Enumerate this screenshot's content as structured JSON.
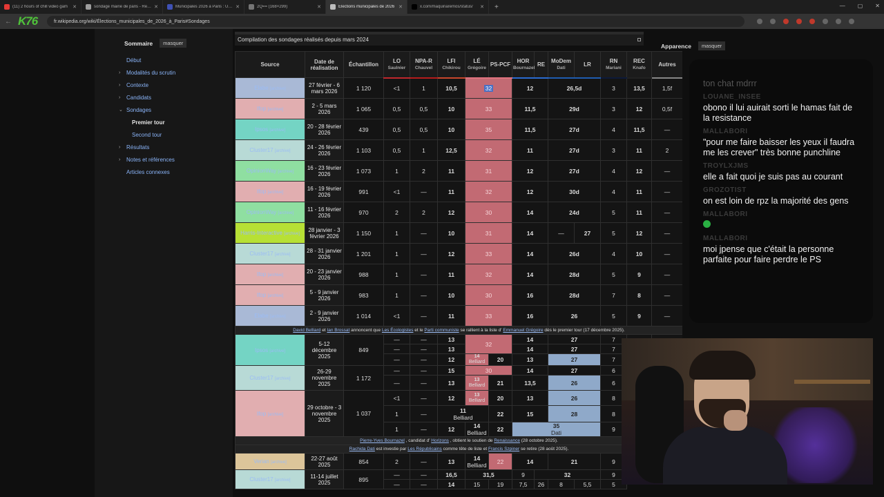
{
  "tabs": [
    {
      "title": "(11) 2 hours of chill video gam",
      "color": "#e53935",
      "active": false
    },
    {
      "title": "sondage mairie de paris - Rech",
      "color": "#9e9e9e",
      "active": false
    },
    {
      "title": "Municipales 2026 à Paris : Un s",
      "color": "#3f51b5",
      "active": false
    },
    {
      "title": "2Q== (168×299)",
      "color": "#757575",
      "active": false
    },
    {
      "title": "Élections municipales de 2026",
      "color": "#bdbdbd",
      "active": true
    },
    {
      "title": "x.com/maquinaremos/status/",
      "color": "#000000",
      "active": false
    }
  ],
  "url": "fr.wikipedia.org/wiki/Élections_municipales_de_2026_à_Paris#Sondages",
  "logo": "K76",
  "toc": {
    "title": "Sommaire",
    "hide": "masquer",
    "items": [
      {
        "label": "Début",
        "arrow": "",
        "level": 0,
        "current": false
      },
      {
        "label": "Modalités du scrutin",
        "arrow": "›",
        "level": 0,
        "current": false
      },
      {
        "label": "Contexte",
        "arrow": "›",
        "level": 0,
        "current": false
      },
      {
        "label": "Candidats",
        "arrow": "›",
        "level": 0,
        "current": false
      },
      {
        "label": "Sondages",
        "arrow": "⌄",
        "level": 0,
        "current": false
      },
      {
        "label": "Premier tour",
        "arrow": "",
        "level": 1,
        "current": true
      },
      {
        "label": "Second tour",
        "arrow": "",
        "level": 1,
        "current": false
      },
      {
        "label": "Résultats",
        "arrow": "›",
        "level": 0,
        "current": false
      },
      {
        "label": "Notes et références",
        "arrow": "›",
        "level": 0,
        "current": false
      },
      {
        "label": "Articles connexes",
        "arrow": "",
        "level": 0,
        "current": false
      }
    ]
  },
  "caption": "Compilation des sondages réalisés depuis mars 2024",
  "appearance": {
    "title": "Apparence",
    "hide": "masquer"
  },
  "table": {
    "headers": {
      "source": "Source",
      "date": "Date de réalisation",
      "sample": "Échantillon",
      "parties": [
        {
          "party": "LO",
          "cand": "Saulnier",
          "color": "#c1272d"
        },
        {
          "party": "NPA-R",
          "cand": "Chauvel",
          "color": "#b71c1c"
        },
        {
          "party": "LFI",
          "cand": "Chikirou",
          "color": "#c9462c"
        },
        {
          "party": "LÉ",
          "cand": "Grégoire",
          "color": "#e0737f"
        },
        {
          "party": "PS-PCF",
          "cand": "",
          "color": "#e0737f"
        },
        {
          "party": "HOR",
          "cand": "Bournazel",
          "color": "#2a6bd1"
        },
        {
          "party": "RE",
          "cand": "",
          "color": "#2a6bd1"
        },
        {
          "party": "MoDem",
          "cand": "Dati",
          "color": "#1f5db2"
        },
        {
          "party": "LR",
          "cand": "",
          "color": "#1f5db2"
        },
        {
          "party": "RN",
          "cand": "Mariani",
          "color": "#0d1a3a"
        },
        {
          "party": "REC",
          "cand": "Knafo",
          "color": "#222222"
        },
        {
          "party": "Autres",
          "cand": "",
          "color": "#888888"
        }
      ]
    },
    "archive": "[archive]",
    "rows": [
      {
        "src": "Elabe",
        "cls": "sc-elabe",
        "date": "27 février - 6 mars 2026",
        "n": "1 120",
        "v": [
          "<1",
          "1",
          "10,5",
          "32",
          "12",
          "26,5d",
          "3",
          "13,5",
          "1,5f"
        ]
      },
      {
        "src": "Ifop",
        "cls": "sc-ifop",
        "date": "2 - 5 mars 2026",
        "n": "1 065",
        "v": [
          "0,5",
          "0,5",
          "10",
          "33",
          "11,5",
          "29d",
          "3",
          "12",
          "0,5f"
        ]
      },
      {
        "src": "Ipsos",
        "cls": "sc-ipsos",
        "date": "20 - 28 février 2026",
        "n": "439",
        "v": [
          "0,5",
          "0,5",
          "10",
          "35",
          "11,5",
          "27d",
          "4",
          "11,5",
          "—"
        ]
      },
      {
        "src": "Cluster17",
        "cls": "sc-cl17",
        "date": "24 - 26 février 2026",
        "n": "1 103",
        "v": [
          "0,5",
          "1",
          "12,5",
          "32",
          "11",
          "27d",
          "3",
          "11",
          "2"
        ]
      },
      {
        "src": "OpinionWay",
        "cls": "sc-opw",
        "date": "16 - 23 février 2026",
        "n": "1 073",
        "v": [
          "1",
          "2",
          "11",
          "31",
          "12",
          "27d",
          "4",
          "12",
          "—"
        ]
      },
      {
        "src": "Ifop",
        "cls": "sc-ifop",
        "date": "16 - 19 février 2026",
        "n": "991",
        "v": [
          "<1",
          "—",
          "11",
          "32",
          "12",
          "30d",
          "4",
          "11",
          "—"
        ]
      },
      {
        "src": "OpinionWay",
        "cls": "sc-opw",
        "date": "11 - 16 février 2026",
        "n": "970",
        "v": [
          "2",
          "2",
          "12",
          "30",
          "14",
          "24d",
          "5",
          "11",
          "—"
        ]
      },
      {
        "src": "Harris-Interactive",
        "cls": "sc-harris",
        "date": "28 janvier - 3 février 2026",
        "n": "1 150",
        "v": [
          "1",
          "—",
          "10",
          "31",
          "14",
          "—",
          "27",
          "5",
          "12",
          "—"
        ],
        "split": true
      },
      {
        "src": "Cluster17",
        "cls": "sc-cl17",
        "date": "28 - 31 janvier 2026",
        "n": "1 201",
        "v": [
          "1",
          "—",
          "12",
          "33",
          "14",
          "26d",
          "4",
          "10",
          "—"
        ]
      },
      {
        "src": "Ifop",
        "cls": "sc-ifop",
        "date": "20 - 23 janvier 2026",
        "n": "988",
        "v": [
          "1",
          "—",
          "11",
          "32",
          "14",
          "28d",
          "5",
          "9",
          "—"
        ]
      },
      {
        "src": "Ifop",
        "cls": "sc-ifop",
        "date": "5 - 9 janvier 2026",
        "n": "983",
        "v": [
          "1",
          "—",
          "10",
          "30",
          "16",
          "28d",
          "7",
          "8",
          "—"
        ]
      },
      {
        "src": "Elabe",
        "cls": "sc-elabe",
        "date": "2 - 9 janvier 2026",
        "n": "1 014",
        "v": [
          "<1",
          "—",
          "11",
          "33",
          "16",
          "26",
          "5",
          "9",
          "—"
        ]
      }
    ],
    "note1": {
      "a": "David Belliard",
      "b": "et",
      "c": "Ian Brossat",
      "d": "annoncent que",
      "e": "Les Écologistes",
      "f": "et le",
      "g": "Parti communiste",
      "h": "se rallient à la liste d'",
      "i": "Emmanuel Grégoire",
      "j": "dès le premier tour (17 décembre 2025)."
    },
    "ipsos_dec": {
      "src": "Ipsos",
      "date": "5-12 décembre 2025",
      "n": "849",
      "r": [
        [
          "—",
          "—",
          "13",
          "32",
          "14",
          "27",
          "7"
        ],
        [
          "—",
          "—",
          "13",
          "13",
          "14",
          "27",
          "7"
        ],
        [
          "—",
          "—",
          "12",
          "14",
          "20",
          "13",
          "27",
          "7"
        ]
      ],
      "belliard": "Belliard"
    },
    "cl17_nov": {
      "src": "Cluster17",
      "date": "26-29 novembre 2025",
      "n": "1 172",
      "r": [
        [
          "—",
          "—",
          "15",
          "30",
          "14",
          "27",
          "6"
        ],
        [
          "—",
          "—",
          "13",
          "13",
          "21",
          "13,5",
          "26",
          "6"
        ]
      ]
    },
    "ifop_oct": {
      "src": "Ifop",
      "date": "29 octobre - 3 novembre 2025",
      "n": "1 037",
      "r": [
        [
          "<1",
          "—",
          "12",
          "13",
          "20",
          "13",
          "26",
          "8"
        ],
        [
          "1",
          "—",
          "11",
          "19",
          "22",
          "15",
          "28",
          "8"
        ],
        [
          "1",
          "—",
          "12",
          "14",
          "22",
          "35",
          "9"
        ]
      ],
      "dati": "Dati"
    },
    "note2": {
      "a": "Pierre-Yves Bournazel",
      "b": ", candidat d'",
      "c": "Horizons",
      "d": ", obtient le soutien de",
      "e": "Renaissance",
      "f": "(28 octobre 2025)."
    },
    "note3": {
      "a": "Rachida Dati",
      "b": "est investie par",
      "c": "Les Républicains",
      "d": "comme tête de liste et",
      "e": "Francis Szpiner",
      "f": "se retire (28 août 2025)."
    },
    "verian": {
      "src": "Verian",
      "date": "22-27 août 2025",
      "n": "854",
      "v": [
        "2",
        "—",
        "13",
        "14",
        "22",
        "14",
        "21",
        "9"
      ]
    },
    "cl17_jul": {
      "src": "Cluster17",
      "date": "11-14 juillet 2025",
      "n": "895",
      "r": [
        [
          "—",
          "—",
          "16,5",
          "31,5",
          "9",
          "32",
          "9"
        ],
        [
          "—",
          "—",
          "14",
          "15",
          "19",
          "7,5",
          "26",
          "8",
          "5,5",
          "5"
        ]
      ]
    }
  },
  "chat": [
    {
      "user": "",
      "text": "ton chat mdrrr",
      "dim": true
    },
    {
      "user": "LOUANE_INSEE",
      "text": "obono il lui auirait sorti le hamas fait de la resistance"
    },
    {
      "user": "MALLABORI",
      "text": "\"pour me faire baisser les yeux il faudra me les crever\" très bonne punchline"
    },
    {
      "user": "TROYLXJMS",
      "text": "elle a fait quoi je suis pas au courant"
    },
    {
      "user": "GROZOTIST",
      "text": "on est loin de rpz la majorité des gens"
    },
    {
      "user": "MALLABORI",
      "text": "",
      "emoji": true
    },
    {
      "user": "MALLABORI",
      "text": "moi jpense que c'était la personne parfaite pour faire perdre le PS"
    }
  ]
}
